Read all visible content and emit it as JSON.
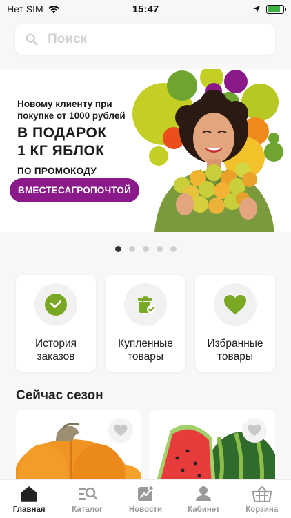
{
  "status_bar": {
    "carrier": "Нет SIM",
    "time": "15:47",
    "icons": [
      "wifi-icon",
      "location-arrow-icon",
      "battery-charging-icon"
    ],
    "battery_level": 0.8
  },
  "search": {
    "placeholder": "Поиск",
    "value": ""
  },
  "banner": {
    "line1": "Новому клиенту при покупке от 1000 рублей",
    "headline1": "В ПОДАРОК",
    "headline2": "1 КГ ЯБЛОК",
    "line3": "ПО ПРОМОКОДУ",
    "promo_code": "ВМЕСТЕСАГРОПОЧТОЙ",
    "colors": {
      "accent": "#8a1a8a",
      "green": "#a6c52b"
    }
  },
  "carousel": {
    "count": 5,
    "active_index": 0
  },
  "quick_links": [
    {
      "label": "История\nзаказов",
      "icon": "check-circle-icon"
    },
    {
      "label": "Купленные\nтовары",
      "icon": "bag-check-icon"
    },
    {
      "label": "Избранные\nтовары",
      "icon": "heart-icon"
    }
  ],
  "season": {
    "title": "Сейчас сезон",
    "products": [
      {
        "name": "pumpkin",
        "icon": "heart-outline-icon"
      },
      {
        "name": "watermelon",
        "icon": "heart-outline-icon"
      }
    ]
  },
  "tabbar": {
    "items": [
      {
        "label": "Главная",
        "icon": "home-icon",
        "active": true
      },
      {
        "label": "Каталог",
        "icon": "catalog-search-icon",
        "active": false
      },
      {
        "label": "Новости",
        "icon": "news-chart-icon",
        "active": false
      },
      {
        "label": "Кабинет",
        "icon": "user-icon",
        "active": false
      },
      {
        "label": "Корзина",
        "icon": "basket-icon",
        "active": false
      }
    ]
  },
  "colors": {
    "brand_green": "#7aa824",
    "inactive": "#9a9a9a"
  }
}
